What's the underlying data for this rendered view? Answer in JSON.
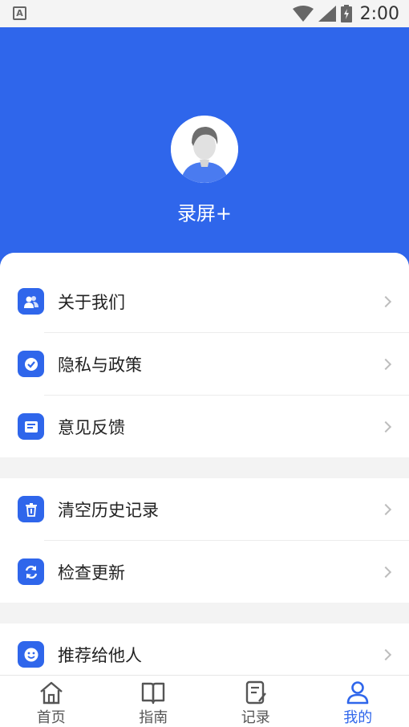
{
  "status": {
    "time": "2:00",
    "app_icon": "A"
  },
  "profile": {
    "name": "录屏+"
  },
  "menu": {
    "group1": [
      {
        "label": "关于我们",
        "icon": "users-icon"
      },
      {
        "label": "隐私与政策",
        "icon": "shield-check-icon"
      },
      {
        "label": "意见反馈",
        "icon": "feedback-icon"
      }
    ],
    "group2": [
      {
        "label": "清空历史记录",
        "icon": "trash-icon"
      },
      {
        "label": "检查更新",
        "icon": "refresh-icon"
      }
    ],
    "group3": [
      {
        "label": "推荐给他人",
        "icon": "smile-icon"
      }
    ]
  },
  "tabs": [
    {
      "label": "首页",
      "icon": "home-icon"
    },
    {
      "label": "指南",
      "icon": "book-icon"
    },
    {
      "label": "记录",
      "icon": "note-icon"
    },
    {
      "label": "我的",
      "icon": "person-icon",
      "active": true
    }
  ],
  "colors": {
    "accent": "#2f66eb",
    "background": "#f3f3f3"
  }
}
